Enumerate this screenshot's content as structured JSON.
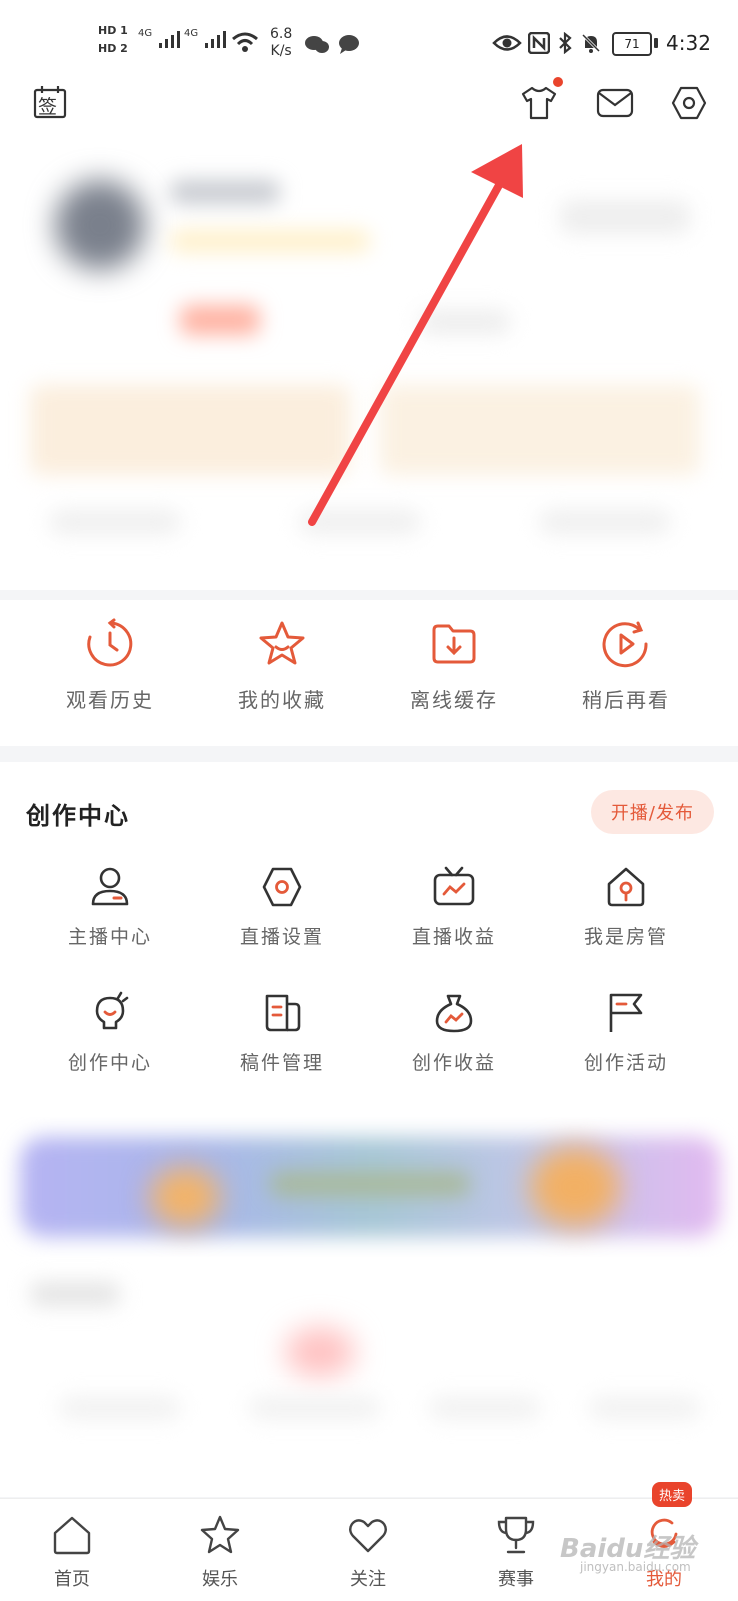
{
  "status_bar": {
    "hd1": "HD 1",
    "hd2": "HD 2",
    "net1": "4G",
    "net2": "4G",
    "speed_value": "6.8",
    "speed_unit": "K/s",
    "battery": "71",
    "time": "4:32"
  },
  "toolbar": {
    "signin_label": "签",
    "icons": [
      "calendar-sign-icon",
      "tshirt-icon",
      "mail-icon",
      "settings-icon"
    ]
  },
  "quick_actions": [
    {
      "label": "观看历史",
      "icon": "history-icon"
    },
    {
      "label": "我的收藏",
      "icon": "star-icon"
    },
    {
      "label": "离线缓存",
      "icon": "download-folder-icon"
    },
    {
      "label": "稍后再看",
      "icon": "play-later-icon"
    }
  ],
  "creator": {
    "title": "创作中心",
    "action_button": "开播/发布",
    "items": [
      {
        "label": "主播中心",
        "icon": "anchor-user-icon"
      },
      {
        "label": "直播设置",
        "icon": "live-settings-icon"
      },
      {
        "label": "直播收益",
        "icon": "tv-income-icon"
      },
      {
        "label": "我是房管",
        "icon": "house-manager-icon"
      },
      {
        "label": "创作中心",
        "icon": "bulb-icon"
      },
      {
        "label": "稿件管理",
        "icon": "manuscript-icon"
      },
      {
        "label": "创作收益",
        "icon": "money-bag-icon"
      },
      {
        "label": "创作活动",
        "icon": "flag-icon"
      }
    ]
  },
  "bottom_nav": {
    "items": [
      {
        "label": "首页",
        "icon": "home-icon"
      },
      {
        "label": "娱乐",
        "icon": "star-outline-icon"
      },
      {
        "label": "关注",
        "icon": "heart-icon"
      },
      {
        "label": "赛事",
        "icon": "trophy-icon"
      },
      {
        "label": "我的",
        "icon": "profile-icon"
      }
    ],
    "active_index": 4,
    "badge": "热卖"
  },
  "watermark": {
    "brand": "Baidu经验",
    "url": "jingyan.baidu.com"
  },
  "colors": {
    "accent": "#e45a3a",
    "arrow": "#f04444",
    "badge": "#e9442c"
  }
}
